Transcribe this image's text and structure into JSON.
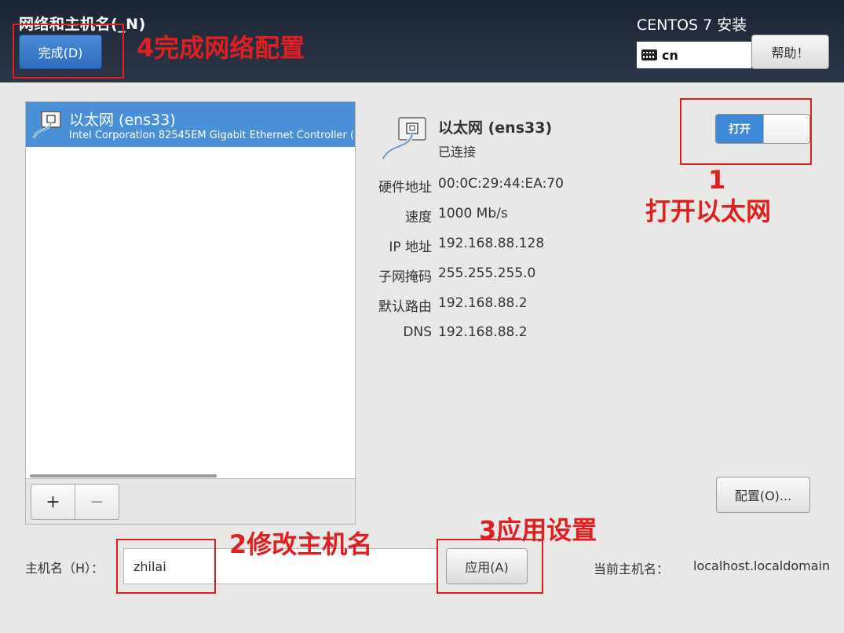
{
  "header": {
    "title": "网络和主机名(_N)",
    "done_label": "完成(D)",
    "install_title": "CENTOS 7 安装",
    "keyboard_layout": "cn",
    "help_label": "帮助！"
  },
  "device_list": {
    "items": [
      {
        "name": "以太网 (ens33)",
        "description": "Intel Corporation 82545EM Gigabit Ethernet Controller ("
      }
    ],
    "add_label": "+",
    "remove_label": "−"
  },
  "detail": {
    "name": "以太网 (ens33)",
    "status": "已连接",
    "toggle_label": "打开",
    "rows": [
      {
        "label": "硬件地址",
        "value": "00:0C:29:44:EA:70"
      },
      {
        "label": "速度",
        "value": "1000 Mb/s"
      },
      {
        "label": "IP 地址",
        "value": "192.168.88.128"
      },
      {
        "label": "子网掩码",
        "value": "255.255.255.0"
      },
      {
        "label": "默认路由",
        "value": "192.168.88.2"
      },
      {
        "label": "DNS",
        "value": "192.168.88.2"
      }
    ],
    "config_label": "配置(O)..."
  },
  "hostname": {
    "label": "主机名（H）：",
    "value": "zhilai",
    "apply_label": "应用(A)",
    "current_label": "当前主机名：",
    "current_value": "localhost.localdomain"
  },
  "annotations": {
    "step1_number": "1",
    "step1_text": "打开以太网",
    "step2_text": "2修改主机名",
    "step3_text": "3应用设置",
    "step4_text": "4完成网络配置"
  },
  "colors": {
    "header_bg": "#222b3b",
    "accent": "#4a90d9",
    "annotation": "#e02020"
  }
}
